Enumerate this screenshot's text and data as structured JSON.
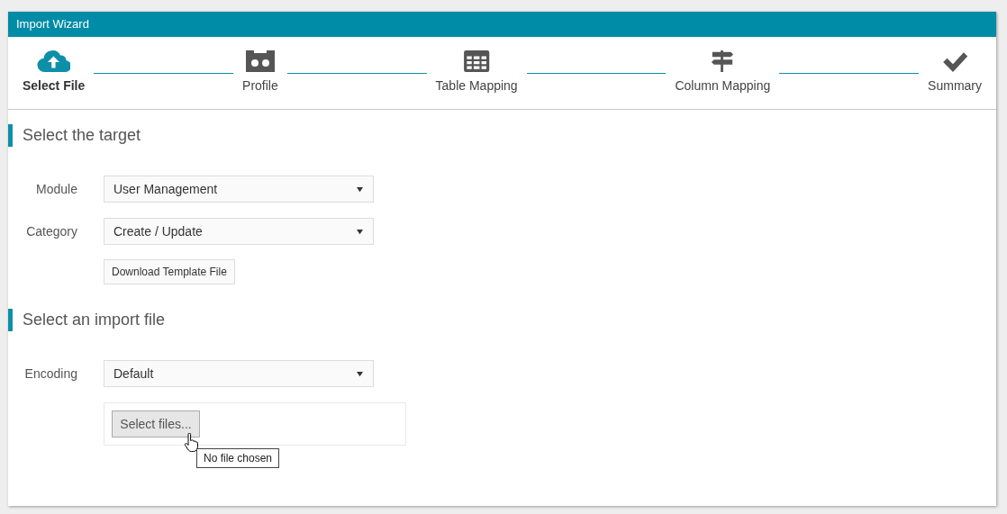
{
  "window": {
    "title": "Import Wizard"
  },
  "steps": [
    {
      "label": "Select File",
      "selected": true
    },
    {
      "label": "Profile",
      "selected": false
    },
    {
      "label": "Table Mapping",
      "selected": false
    },
    {
      "label": "Column Mapping",
      "selected": false
    },
    {
      "label": "Summary",
      "selected": false
    }
  ],
  "sections": [
    {
      "title": "Select the target",
      "fields": [
        {
          "kind": "select",
          "label": "Module",
          "value": "User Management"
        },
        {
          "kind": "select",
          "label": "Category",
          "value": "Create / Update"
        },
        {
          "kind": "button",
          "label": "Download Template File"
        }
      ]
    },
    {
      "title": "Select an import file",
      "fields": [
        {
          "kind": "select",
          "label": "Encoding",
          "value": "Default"
        },
        {
          "kind": "file",
          "button": "Select files...",
          "tooltip": "No file chosen"
        }
      ]
    }
  ]
}
